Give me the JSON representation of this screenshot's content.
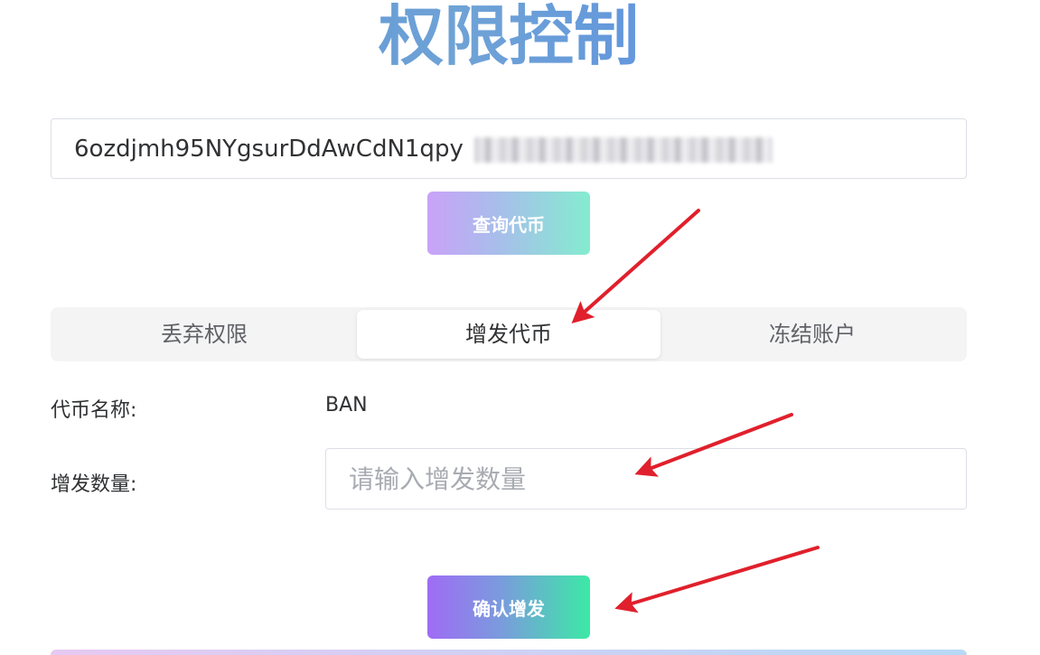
{
  "page": {
    "title": "权限控制"
  },
  "address": {
    "value": "6ozdjmh95NYgsurDdAwCdN1qpy"
  },
  "query_button": {
    "label": "查询代币"
  },
  "tabs": [
    {
      "label": "丢弃权限",
      "active": false
    },
    {
      "label": "增发代币",
      "active": true
    },
    {
      "label": "冻结账户",
      "active": false
    }
  ],
  "form": {
    "token_name_label": "代币名称:",
    "token_name_value": "BAN",
    "amount_label": "增发数量:",
    "amount_placeholder": "请输入增发数量",
    "amount_value": ""
  },
  "confirm_button": {
    "label": "确认增发"
  },
  "colors": {
    "annotation_arrow": "#e0202c",
    "title_gradient_start": "#4f86d8",
    "title_gradient_end": "#7d74dc",
    "button_gradient_start": "#9f6cf5",
    "button_gradient_end": "#3ce9a6"
  },
  "icons": {
    "annotation": "red-arrow-icon"
  }
}
